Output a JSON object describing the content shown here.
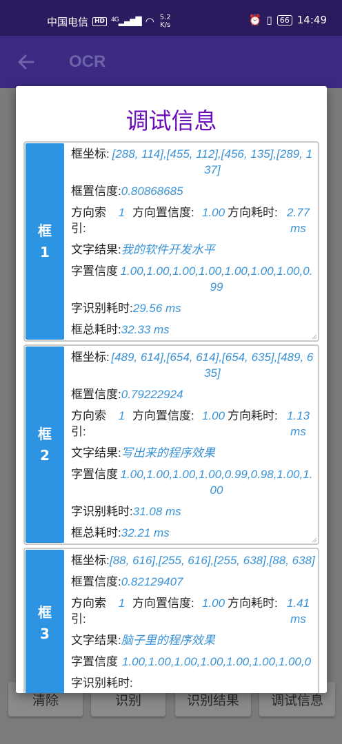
{
  "status_bar": {
    "carrier": "中国电信",
    "hd": "HD",
    "signal": "4G",
    "speed_value": "5.2",
    "speed_unit": "K/s",
    "battery": "66",
    "time": "14:49"
  },
  "app_bar": {
    "title": "OCR"
  },
  "bottom_buttons": [
    "清除",
    "识别",
    "识别结果",
    "调试信息"
  ],
  "dialog": {
    "title": "调试信息",
    "labels": {
      "box_coords": "框坐标:",
      "box_conf": "框置信度:",
      "dir_index": "方向索引:",
      "dir_conf": "方向置信度:",
      "dir_time": "方向耗时:",
      "text_result": "文字结果:",
      "char_conf": "字置信度",
      "char_time": "字识别耗时:",
      "box_total_time": "框总耗时:"
    },
    "boxes": [
      {
        "label_char": "框",
        "label_num": "1",
        "coords": "[288, 114],[455, 112],[456, 135],[289, 137]",
        "box_conf": "0.80868685",
        "dir_index": "1",
        "dir_conf": "1.00",
        "dir_time": "2.77 ms",
        "text_result": "我的软件开发水平",
        "char_conf": "1.00,1.00,1.00,1.00,1.00,1.00,1.00,0.99",
        "char_time": "29.56 ms",
        "box_total_time": "32.33 ms"
      },
      {
        "label_char": "框",
        "label_num": "2",
        "coords": "[489, 614],[654, 614],[654, 635],[489, 635]",
        "box_conf": "0.79222924",
        "dir_index": "1",
        "dir_conf": "1.00",
        "dir_time": "1.13 ms",
        "text_result": "写出来的程序效果",
        "char_conf": "1.00,1.00,1.00,1.00,0.99,0.98,1.00,1.00",
        "char_time": "31.08 ms",
        "box_total_time": "32.21 ms"
      },
      {
        "label_char": "框",
        "label_num": "3",
        "coords": "[88, 616],[255, 616],[255, 638],[88, 638]",
        "box_conf": "0.82129407",
        "dir_index": "1",
        "dir_conf": "1.00",
        "dir_time": "1.41 ms",
        "text_result": "脑子里的程序效果",
        "char_conf": "1.00,1.00,1.00,1.00,1.00,1.00,1.00,0",
        "char_time": "",
        "box_total_time": ""
      }
    ]
  }
}
